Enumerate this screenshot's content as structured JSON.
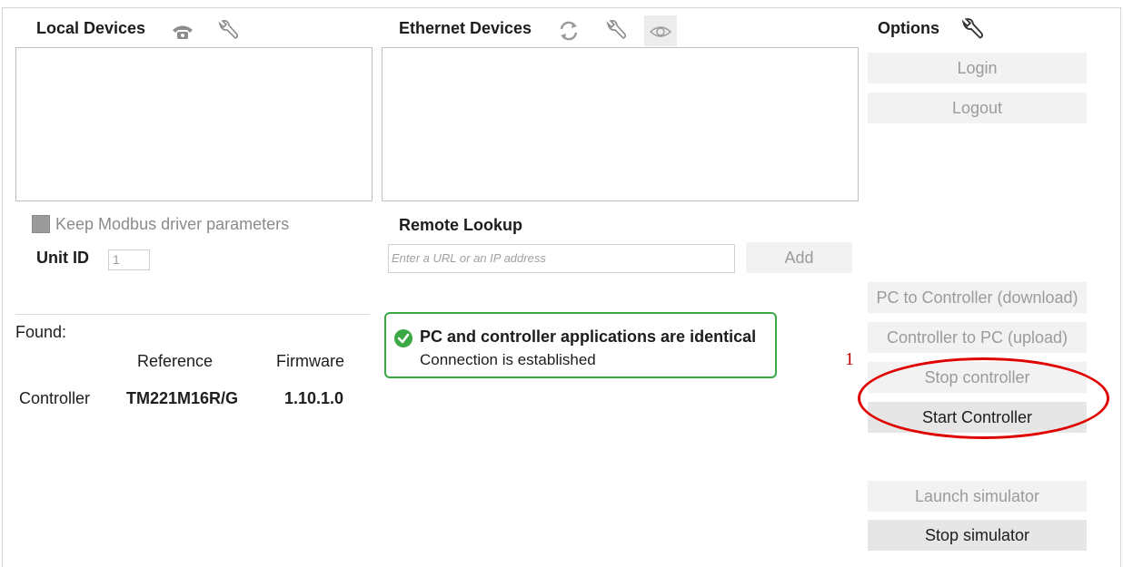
{
  "local_devices": {
    "title": "Local Devices",
    "keep_modbus_label": "Keep Modbus driver parameters",
    "unit_id_label": "Unit ID",
    "unit_id_value": "1",
    "icons": [
      "phone-icon",
      "wrench-icon"
    ]
  },
  "ethernet_devices": {
    "title": "Ethernet Devices",
    "remote_lookup_label": "Remote Lookup",
    "url_placeholder": "Enter a URL or an IP address",
    "add_label": "Add",
    "icons": [
      "refresh-icon",
      "wrench-icon",
      "eye-icon"
    ]
  },
  "options": {
    "title": "Options",
    "login_label": "Login",
    "logout_label": "Logout",
    "pc_to_controller_label": "PC to Controller (download)",
    "controller_to_pc_label": "Controller to PC (upload)",
    "stop_controller_label": "Stop controller",
    "start_controller_label": "Start Controller",
    "launch_simulator_label": "Launch simulator",
    "stop_simulator_label": "Stop simulator"
  },
  "found": {
    "label": "Found:",
    "columns": [
      "Reference",
      "Firmware"
    ],
    "row": {
      "name": "Controller",
      "reference": "TM221M16R/G",
      "firmware": "1.10.1.0"
    }
  },
  "status": {
    "title": "PC and controller applications are identical",
    "subtitle": "Connection is established",
    "color": "#3aa843"
  },
  "annotation": {
    "number": "1",
    "color": "#e00000"
  }
}
